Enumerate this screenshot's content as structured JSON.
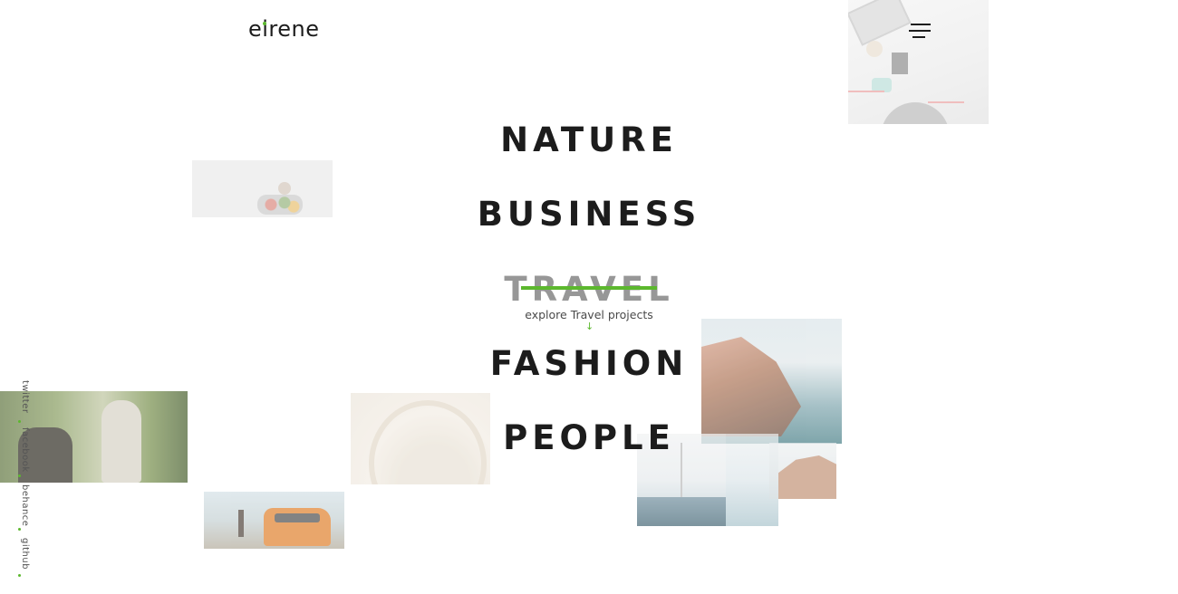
{
  "brand": {
    "logo_text": "eirene",
    "accent": "#5cb82e"
  },
  "menu": {
    "icon": "hamburger-menu-icon"
  },
  "categories": {
    "items": [
      {
        "label": "NATURE"
      },
      {
        "label": "BUSINESS"
      },
      {
        "label": "TRAVEL",
        "active": true
      },
      {
        "label": "FASHION"
      },
      {
        "label": "PEOPLE"
      }
    ],
    "active_hint": "explore Travel projects",
    "active_arrow": "↓"
  },
  "social": [
    {
      "label": "twitter"
    },
    {
      "label": "facebook"
    },
    {
      "label": "behance"
    },
    {
      "label": "github"
    }
  ]
}
